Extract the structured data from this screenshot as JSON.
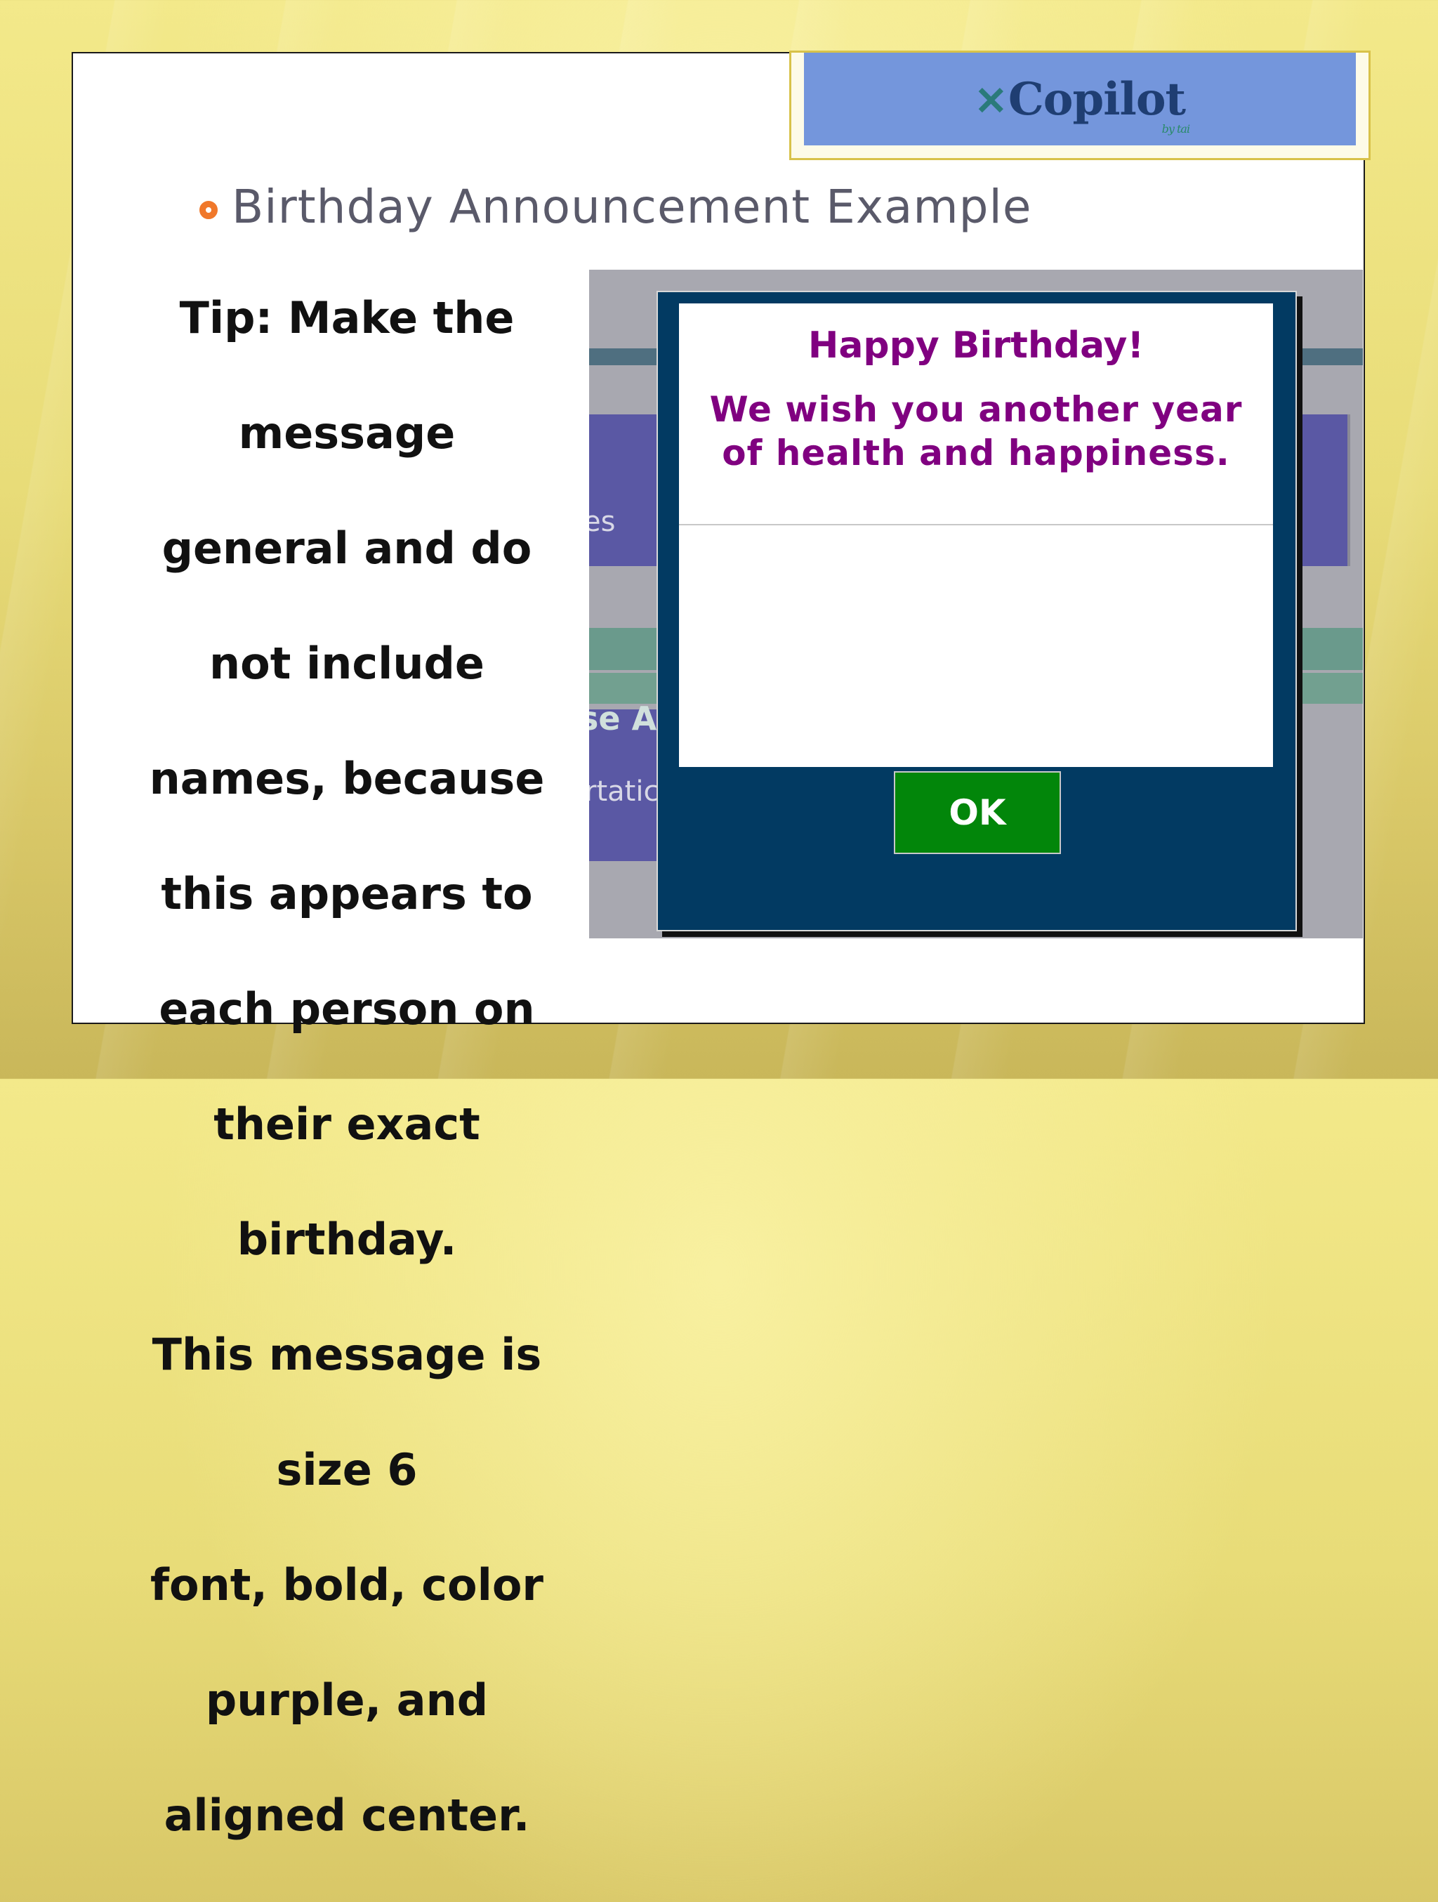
{
  "slide": {
    "bullet_title": "Birthday Announcement Example",
    "tip_lines": [
      "Tip: Make the",
      "message",
      "general and do",
      "not include",
      "names, because",
      "this appears to",
      "each person on",
      "their exact",
      "birthday.",
      "This message is",
      "size 6",
      "font, bold, color",
      "purple, and",
      "aligned center."
    ]
  },
  "logo": {
    "text": "Copilot",
    "subtext": "by tai",
    "icon": "star-burst-icon"
  },
  "background_app": {
    "partial_labels": [
      "es",
      "se Ac",
      "rtatic"
    ]
  },
  "dialog": {
    "title": "Happy Birthday!",
    "body_line1": "We wish you another year",
    "body_line2": "of health and happiness.",
    "ok_label": "OK"
  },
  "colors": {
    "message_text": "#800080",
    "dialog_frame": "#023a62",
    "ok_button": "#02860a",
    "bullet": "#f0782a",
    "logo_bg": "#7496dc"
  }
}
